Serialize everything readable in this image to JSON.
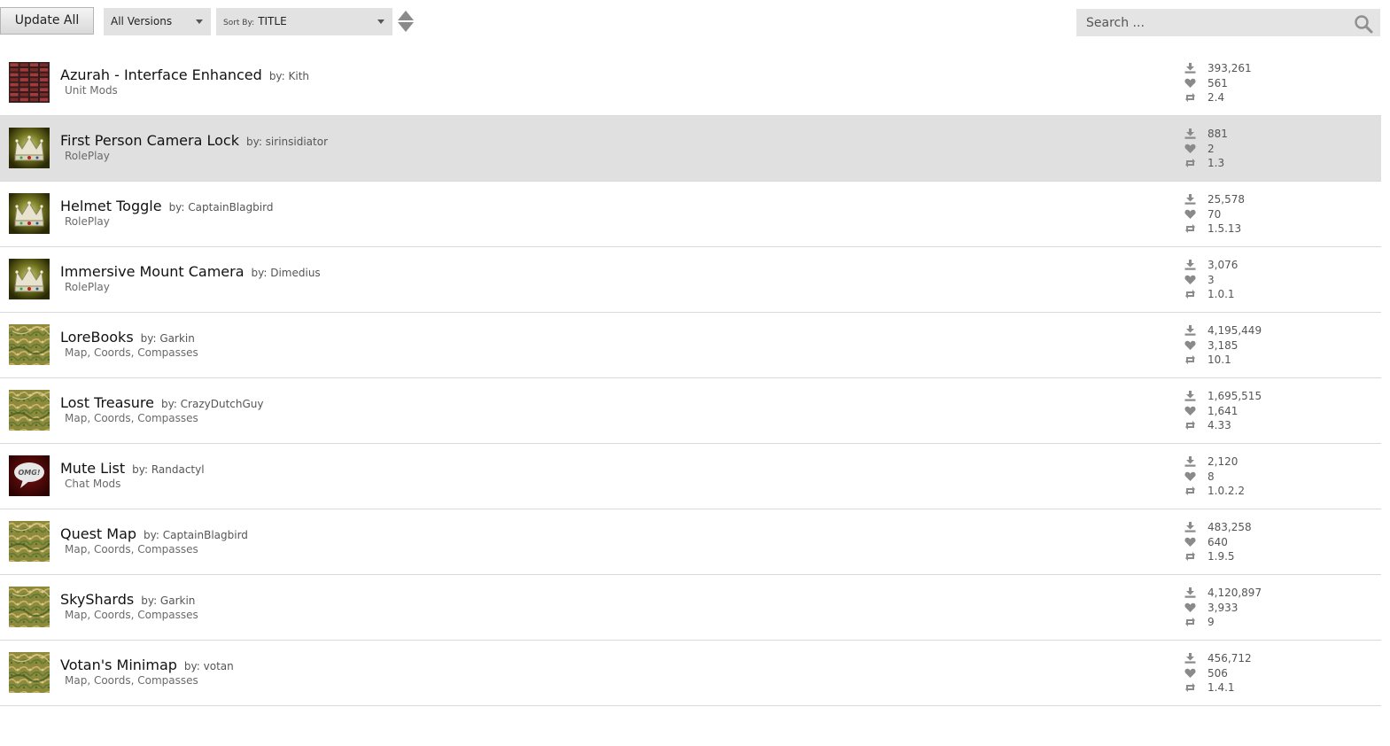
{
  "toolbar": {
    "update_all_label": "Update All",
    "versions_dropdown": {
      "selected": "All Versions"
    },
    "sort_dropdown": {
      "prefix": "Sort By:",
      "selected": "TITLE"
    },
    "search": {
      "placeholder": "Search ..."
    }
  },
  "addons": [
    {
      "title": "Azurah - Interface Enhanced",
      "author": "by: Kith",
      "category": "Unit Mods",
      "downloads": "393,261",
      "favorites": "561",
      "version": "2.4",
      "icon": "interface-thumbnail",
      "selected": false
    },
    {
      "title": "First Person Camera Lock",
      "author": "by: sirinsidiator",
      "category": "RolePlay",
      "downloads": "881",
      "favorites": "2",
      "version": "1.3",
      "icon": "crown-thumbnail",
      "selected": true
    },
    {
      "title": "Helmet Toggle",
      "author": "by: CaptainBlagbird",
      "category": "RolePlay",
      "downloads": "25,578",
      "favorites": "70",
      "version": "1.5.13",
      "icon": "crown-thumbnail",
      "selected": false
    },
    {
      "title": "Immersive Mount Camera",
      "author": "by: Dimedius",
      "category": "RolePlay",
      "downloads": "3,076",
      "favorites": "3",
      "version": "1.0.1",
      "icon": "crown-thumbnail",
      "selected": false
    },
    {
      "title": "LoreBooks",
      "author": "by: Garkin",
      "category": "Map, Coords, Compasses",
      "downloads": "4,195,449",
      "favorites": "3,185",
      "version": "10.1",
      "icon": "map-thumbnail",
      "selected": false
    },
    {
      "title": "Lost Treasure",
      "author": "by: CrazyDutchGuy",
      "category": "Map, Coords, Compasses",
      "downloads": "1,695,515",
      "favorites": "1,641",
      "version": "4.33",
      "icon": "map-thumbnail",
      "selected": false
    },
    {
      "title": "Mute List",
      "author": "by: Randactyl",
      "category": "Chat Mods",
      "downloads": "2,120",
      "favorites": "8",
      "version": "1.0.2.2",
      "icon": "chat-bubble-thumbnail",
      "bubble_text": "OMG!",
      "selected": false
    },
    {
      "title": "Quest Map",
      "author": "by: CaptainBlagbird",
      "category": "Map, Coords, Compasses",
      "downloads": "483,258",
      "favorites": "640",
      "version": "1.9.5",
      "icon": "map-thumbnail",
      "selected": false
    },
    {
      "title": "SkyShards",
      "author": "by: Garkin",
      "category": "Map, Coords, Compasses",
      "downloads": "4,120,897",
      "favorites": "3,933",
      "version": "9",
      "icon": "map-thumbnail",
      "selected": false
    },
    {
      "title": "Votan's Minimap",
      "author": "by: votan",
      "category": "Map, Coords, Compasses",
      "downloads": "456,712",
      "favorites": "506",
      "version": "1.4.1",
      "icon": "map-thumbnail",
      "selected": false
    }
  ],
  "colors": {
    "selected_row": "#e0e0e0",
    "divider": "#d9d9d9",
    "stat_icon": "#8a8a8a"
  }
}
